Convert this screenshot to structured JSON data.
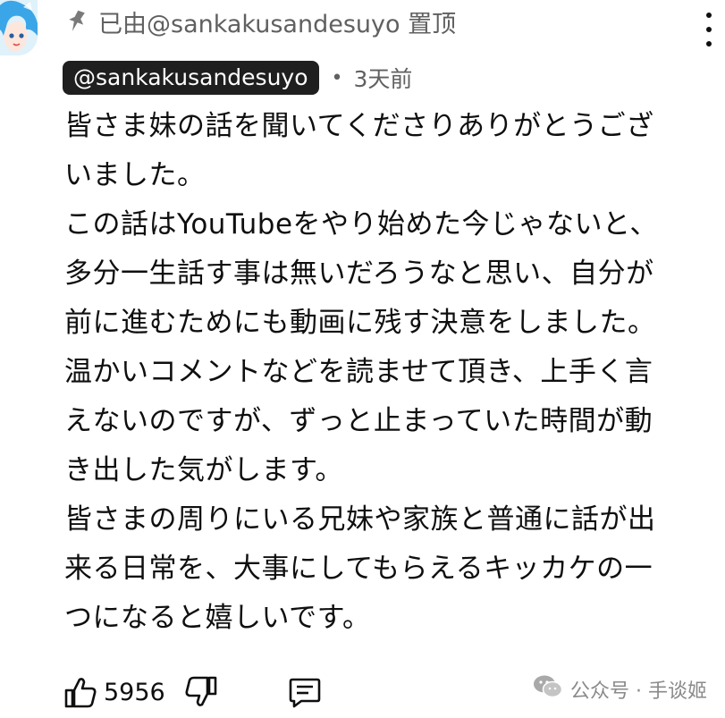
{
  "pinned": {
    "icon": "pin-icon",
    "text": "已由@sankakusandesuyo 置顶"
  },
  "comment": {
    "author": "@sankakusandesuyo",
    "separator": "•",
    "time": "3天前",
    "lines": [
      "皆さま妹の話を聞いてくださりありがとうござ",
      "いました。",
      "この話はYouTubeをやり始めた今じゃないと、",
      "多分一生話す事は無いだろうなと思い、自分が",
      "前に進むためにも動画に残す決意をしました。",
      "温かいコメントなどを読ませて頂き、上手く言",
      "えないのですが、ずっと止まっていた時間が動",
      "き出した気がします。",
      "皆さまの周りにいる兄妹や家族と普通に話が出",
      "来る日常を、大事にしてもらえるキッカケの一",
      "つになると嬉しいです。"
    ]
  },
  "actions": {
    "like_count": "5956",
    "like_icon": "thumbs-up-icon",
    "dislike_icon": "thumbs-down-icon",
    "reply_icon": "reply-comment-icon"
  },
  "watermark": {
    "icon": "wechat-icon",
    "text": "公众号 · 手谈姬"
  },
  "colors": {
    "chip_bg": "#1f1f1f",
    "meta_text": "#606060",
    "body_text": "#0f0f0f"
  }
}
